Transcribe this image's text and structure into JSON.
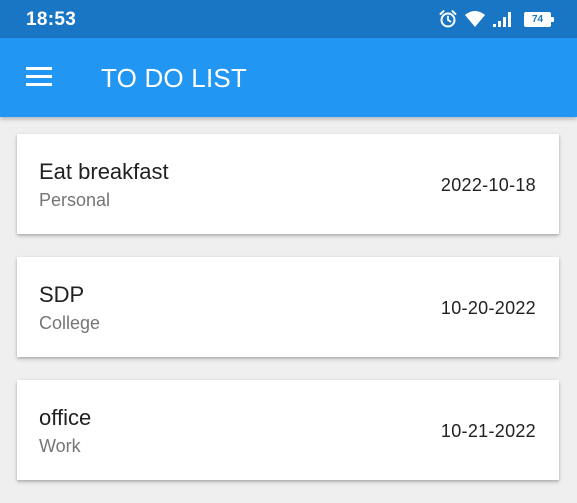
{
  "status_bar": {
    "time": "18:53",
    "battery_level": "74",
    "icons": [
      "alarm-icon",
      "wifi-icon",
      "signal-icon",
      "battery-icon"
    ]
  },
  "app_bar": {
    "menu_icon": "hamburger-menu-icon",
    "title": "TO DO LIST"
  },
  "todos": [
    {
      "title": "Eat breakfast",
      "category": "Personal",
      "date": "2022-10-18"
    },
    {
      "title": "SDP",
      "category": "College",
      "date": "10-20-2022"
    },
    {
      "title": "office",
      "category": "Work",
      "date": "10-21-2022"
    }
  ],
  "colors": {
    "status_bar": "#1976c5",
    "app_bar": "#2196f3",
    "background": "#efefef",
    "card": "#ffffff",
    "primary_text": "#212121",
    "secondary_text": "#757575"
  }
}
